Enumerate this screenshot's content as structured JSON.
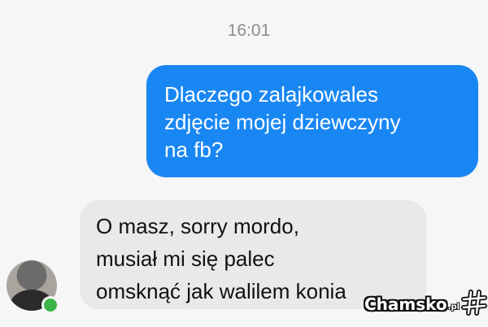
{
  "conversation": {
    "timestamp": "16:01",
    "messages": [
      {
        "direction": "outgoing",
        "lines": [
          "Dlaczego zalajkowales",
          "zdjęcie mojej dziewczyny",
          "na fb?"
        ]
      },
      {
        "direction": "incoming",
        "lines": [
          "O masz, sorry mordo,",
          "musiał mi się palec",
          "omsknąć jak walilem konia"
        ]
      }
    ],
    "contact": {
      "online": true
    }
  },
  "watermark": {
    "text": "Chamsko",
    "suffix": ".pl"
  },
  "colors": {
    "outgoing_bubble": "#1987f3",
    "incoming_bubble": "#e9e9ec",
    "online_dot": "#3bb54a",
    "timestamp": "#8e8e92"
  },
  "icons": {
    "watermark_logo": "hash-logo-icon"
  }
}
